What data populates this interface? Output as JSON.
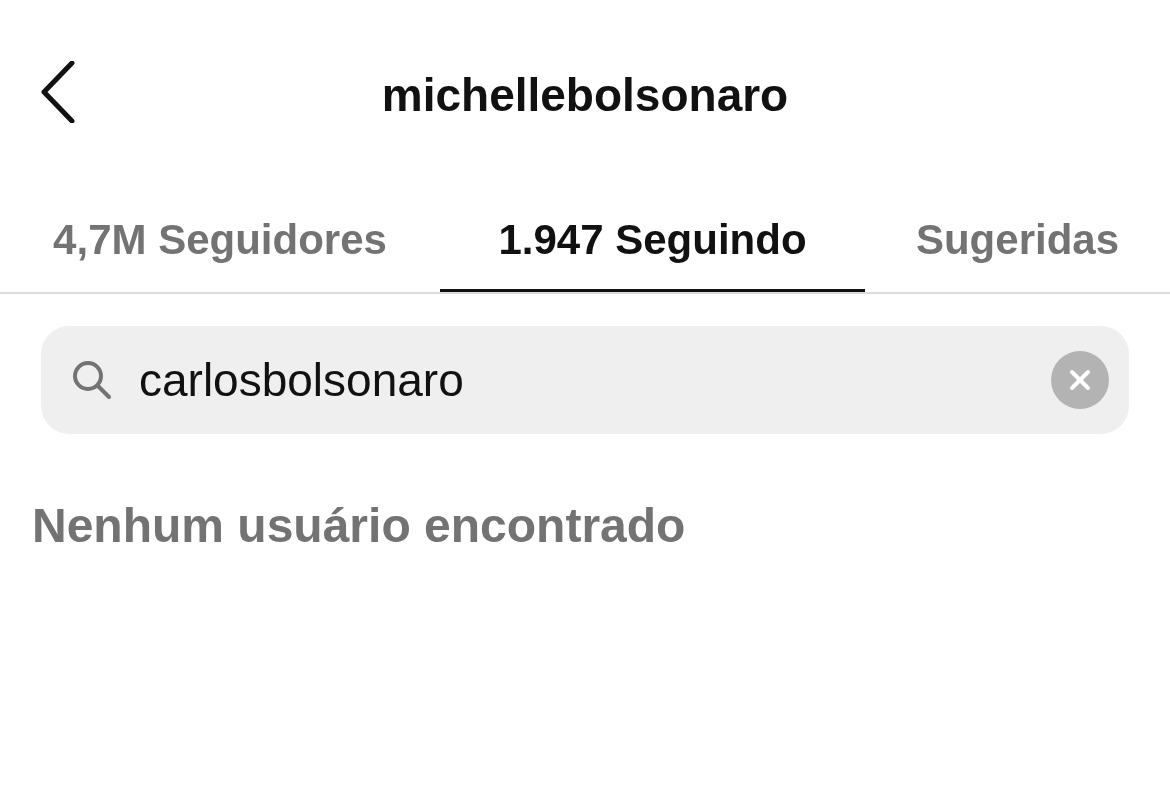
{
  "header": {
    "title": "michellebolsonaro"
  },
  "tabs": [
    {
      "label": "4,7M Seguidores",
      "selected": false
    },
    {
      "label": "1.947 Seguindo",
      "selected": true
    },
    {
      "label": "Sugeridas",
      "selected": false
    }
  ],
  "search": {
    "value": "carlosbolsonaro"
  },
  "message": "Nenhum usuário encontrado"
}
